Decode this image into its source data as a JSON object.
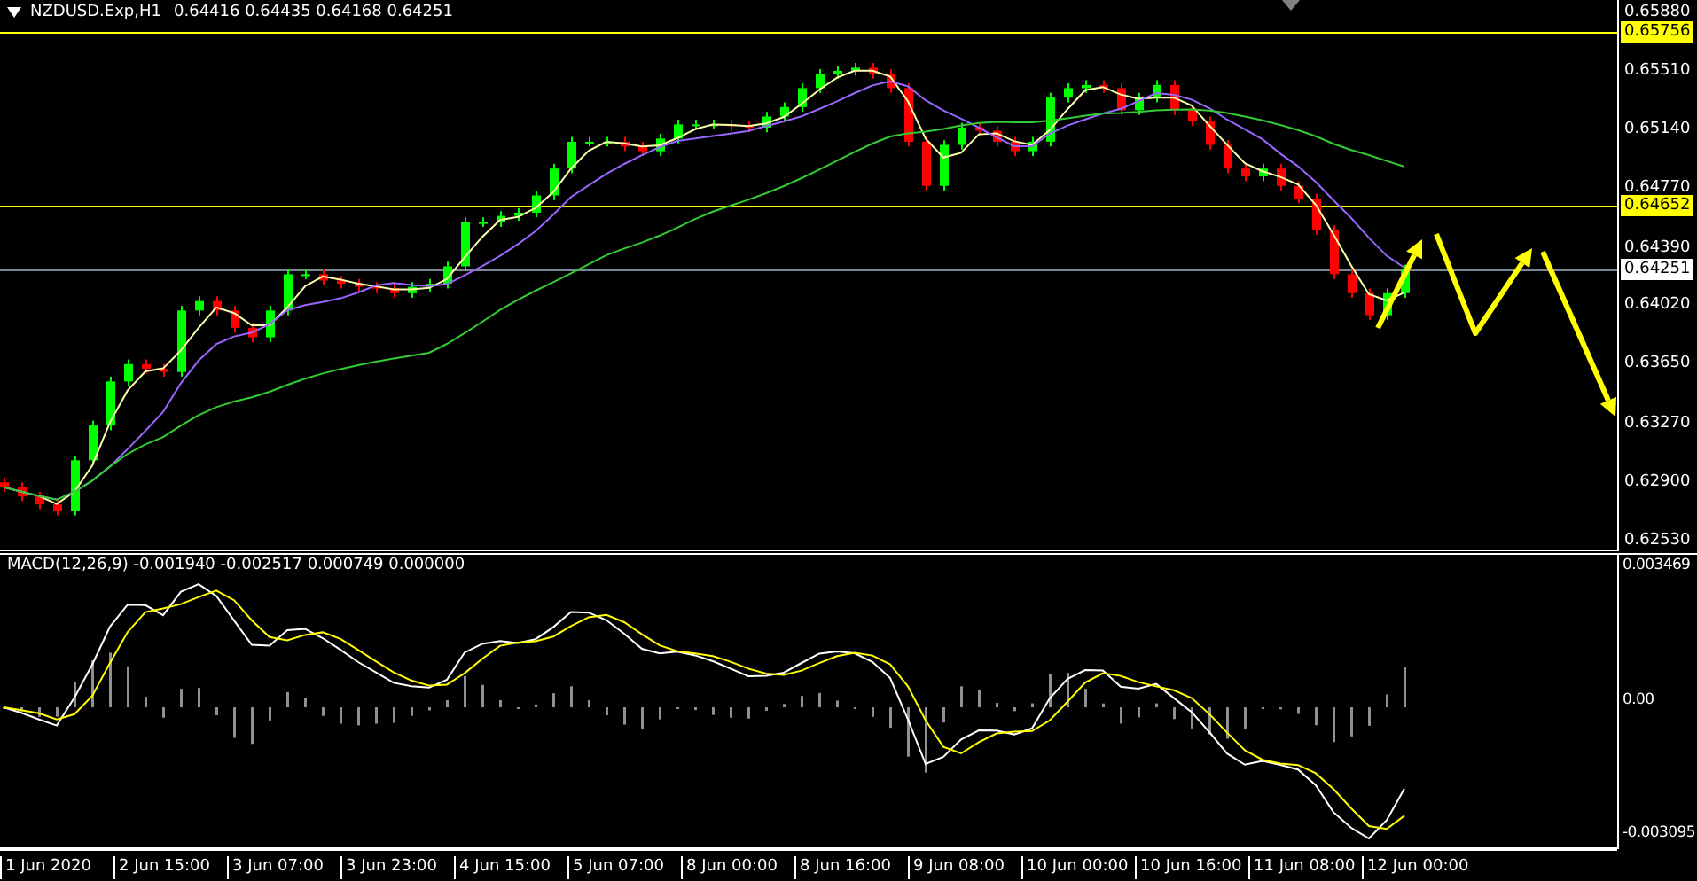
{
  "header": {
    "symbol": "NZDUSD.Exp,H1",
    "ohlc": "0.64416 0.64435 0.64168 0.64251"
  },
  "price_axis": [
    "0.65880",
    "0.65510",
    "0.65140",
    "0.64770",
    "0.64390",
    "0.64020",
    "0.63650",
    "0.63270",
    "0.62900",
    "0.62530"
  ],
  "price_levels": [
    {
      "price": "0.65756",
      "kind": "level"
    },
    {
      "price": "0.64652",
      "kind": "level"
    },
    {
      "price": "0.64251",
      "kind": "bid"
    }
  ],
  "macd_panel": {
    "label": "MACD(12,26,9) -0.001940 -0.002517 0.000749 0.000000",
    "axis_labels": [
      "0.003469",
      "0.00",
      "-0.003095"
    ]
  },
  "time_axis": [
    "1 Jun 2020",
    "2 Jun 15:00",
    "3 Jun 07:00",
    "3 Jun 23:00",
    "4 Jun 15:00",
    "5 Jun 07:00",
    "8 Jun 00:00",
    "8 Jun 16:00",
    "9 Jun 08:00",
    "10 Jun 00:00",
    "10 Jun 16:00",
    "11 Jun 08:00",
    "12 Jun 00:00"
  ]
}
